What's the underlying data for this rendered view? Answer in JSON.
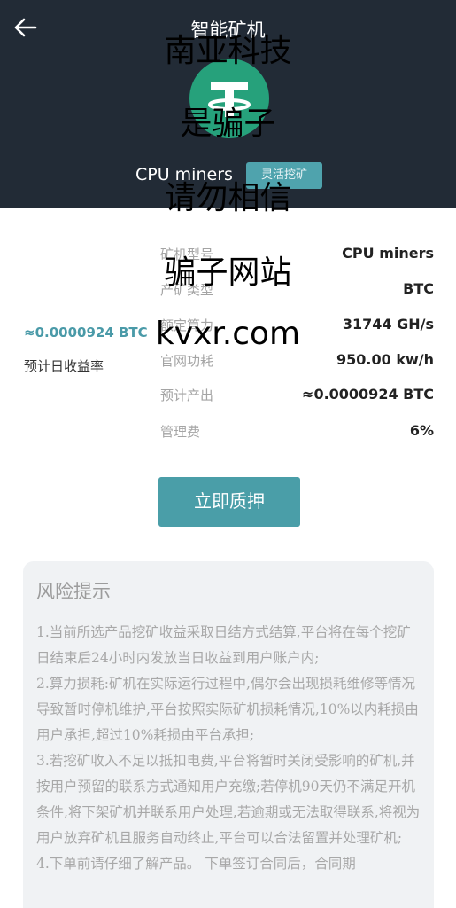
{
  "header": {
    "title": "智能矿机",
    "miner_name": "CPU miners",
    "tag": "灵活挖矿"
  },
  "overlay": [
    "南亚科技",
    "是骗子",
    "请勿相信",
    "骗子网站",
    "kvxr.com"
  ],
  "yield": {
    "value": "≈0.0000924 BTC",
    "label": "预计日收益率"
  },
  "specs": [
    {
      "label": "矿机型号",
      "value": "CPU miners"
    },
    {
      "label": "产矿类型",
      "value": "BTC"
    },
    {
      "label": "额定算力",
      "value": "31744 GH/s"
    },
    {
      "label": "官网功耗",
      "value": "950.00 kw/h"
    },
    {
      "label": "预计产出",
      "value": "≈0.0000924 BTC"
    },
    {
      "label": "管理费",
      "value": "6%"
    }
  ],
  "actions": {
    "pledge": "立即质押"
  },
  "risk": {
    "title": "风险提示",
    "paragraphs": [
      "1.当前所选产品挖矿收益采取日结方式结算,平台将在每个挖矿日结束后24小时内发放当日收益到用户账户内;",
      "2.算力损耗:矿机在实际运行过程中,偶尔会出现损耗维修等情况导致暂时停机维护,平台按照实际矿机损耗情况,10%以内耗损由用户承担,超过10%耗损由平台承担;",
      "3.若挖矿收入不足以抵扣电费,平台将暂时关闭受影响的矿机,并按用户预留的联系方式通知用户充缴;若停机90天仍不满足开机条件,将下架矿机并联系用户处理,若逾期或无法取得联系,将视为用户放弃矿机且服务自动终止,平台可以合法留置并处理矿机;",
      "4.下单前请仔细了解产品。 下单签订合同后，合同期"
    ]
  },
  "colors": {
    "header_bg": "#222b36",
    "accent": "#4a9ea8",
    "coin": "#26a17b"
  }
}
